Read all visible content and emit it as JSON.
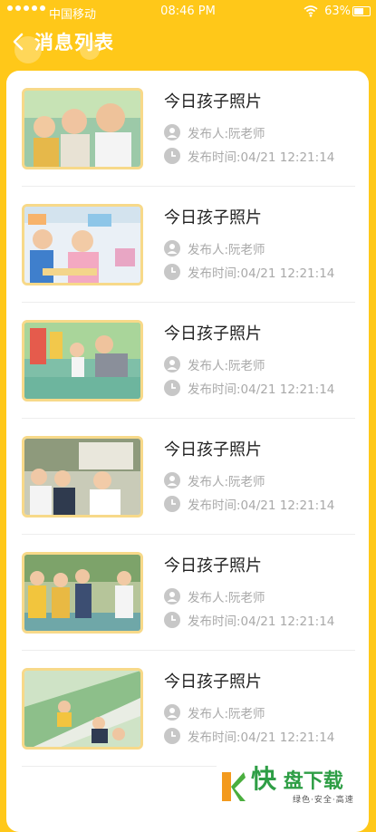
{
  "status_bar": {
    "carrier": "中国移动",
    "time": "08:46 PM",
    "battery": "63%"
  },
  "header": {
    "title": "消息列表"
  },
  "colors": {
    "accent": "#FFC819",
    "thumb_border": "#F7D989",
    "meta_text": "#A9A9A9"
  },
  "messages": [
    {
      "title": "今日孩子照片",
      "author": "发布人:阮老师",
      "time": "发布时间:04/21 12:21:14"
    },
    {
      "title": "今日孩子照片",
      "author": "发布人:阮老师",
      "time": "发布时间:04/21 12:21:14"
    },
    {
      "title": "今日孩子照片",
      "author": "发布人:阮老师",
      "time": "发布时间:04/21 12:21:14"
    },
    {
      "title": "今日孩子照片",
      "author": "发布人:阮老师",
      "time": "发布时间:04/21 12:21:14"
    },
    {
      "title": "今日孩子照片",
      "author": "发布人:阮老师",
      "time": "发布时间:04/21 12:21:14"
    },
    {
      "title": "今日孩子照片",
      "author": "发布人:阮老师",
      "time": "发布时间:04/21 12:21:14"
    }
  ],
  "watermark": {
    "brand_first": "快",
    "brand_rest": "盘下载",
    "tagline": "绿色·安全·高速"
  }
}
